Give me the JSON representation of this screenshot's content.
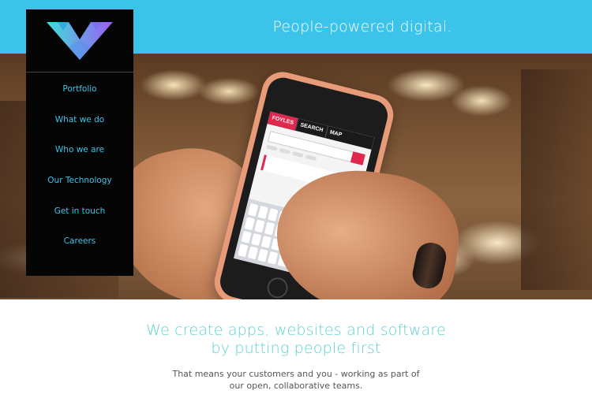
{
  "header": {
    "tagline": "People-powered digital."
  },
  "brand": {
    "logo_icon": "w-triangle-logo",
    "accent_color": "#3cc3ea"
  },
  "nav": {
    "items": [
      {
        "label": "Portfolio"
      },
      {
        "label": "What we do"
      },
      {
        "label": "Who we are"
      },
      {
        "label": "Our Technology"
      },
      {
        "label": "Get in touch"
      },
      {
        "label": "Careers"
      }
    ]
  },
  "hero": {
    "phone_app": {
      "brand": "FOYLES",
      "tab_search": "SEARCH",
      "tab_map": "MAP"
    }
  },
  "intro": {
    "headline": "We create apps, websites and software by putting people first",
    "subtext": "That means your customers and you - working as part of our open, collaborative teams.",
    "headline_color": "#5ed2cf"
  }
}
